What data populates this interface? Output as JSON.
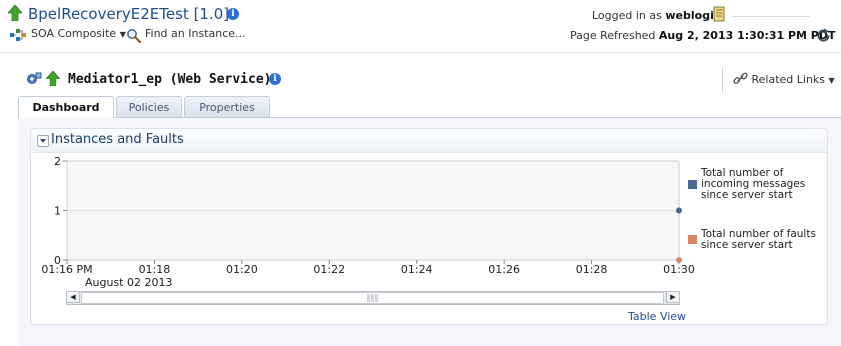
{
  "header": {
    "app_title": "BpelRecoveryE2ETest [1.0]",
    "menu_soa": "SOA Composite",
    "menu_find": "Find an Instance...",
    "logged_in_label": "Logged in as",
    "user": "weblogic",
    "refresh_label": "Page Refreshed",
    "refresh_time": "Aug 2, 2013 1:30:31 PM PDT"
  },
  "subheader": {
    "endpoint_title": "Mediator1_ep (Web Service)",
    "related_links": "Related Links"
  },
  "tabs": [
    {
      "label": "Dashboard",
      "active": true
    },
    {
      "label": "Policies",
      "active": false
    },
    {
      "label": "Properties",
      "active": false
    }
  ],
  "panel": {
    "title": "Instances and Faults",
    "table_view": "Table View"
  },
  "colors": {
    "incoming": "#4a6a93",
    "faults": "#d9896a",
    "link": "#1f4e8c"
  },
  "chart_data": {
    "type": "line",
    "x_tick_labels": [
      "01:16 PM",
      "01:18",
      "01:20",
      "01:22",
      "01:24",
      "01:26",
      "01:28",
      "01:30"
    ],
    "x_sublabel": "August 02 2013",
    "y_tick_labels": [
      "2",
      "1",
      "0"
    ],
    "ylim": [
      0,
      2
    ],
    "grid": true,
    "legend_position": "right",
    "series": [
      {
        "name": "Total number of incoming messages since server start",
        "points": [
          {
            "x": "01:30",
            "y": 1
          }
        ]
      },
      {
        "name": "Total number of faults since server start",
        "points": [
          {
            "x": "01:30",
            "y": 0
          }
        ]
      }
    ]
  }
}
